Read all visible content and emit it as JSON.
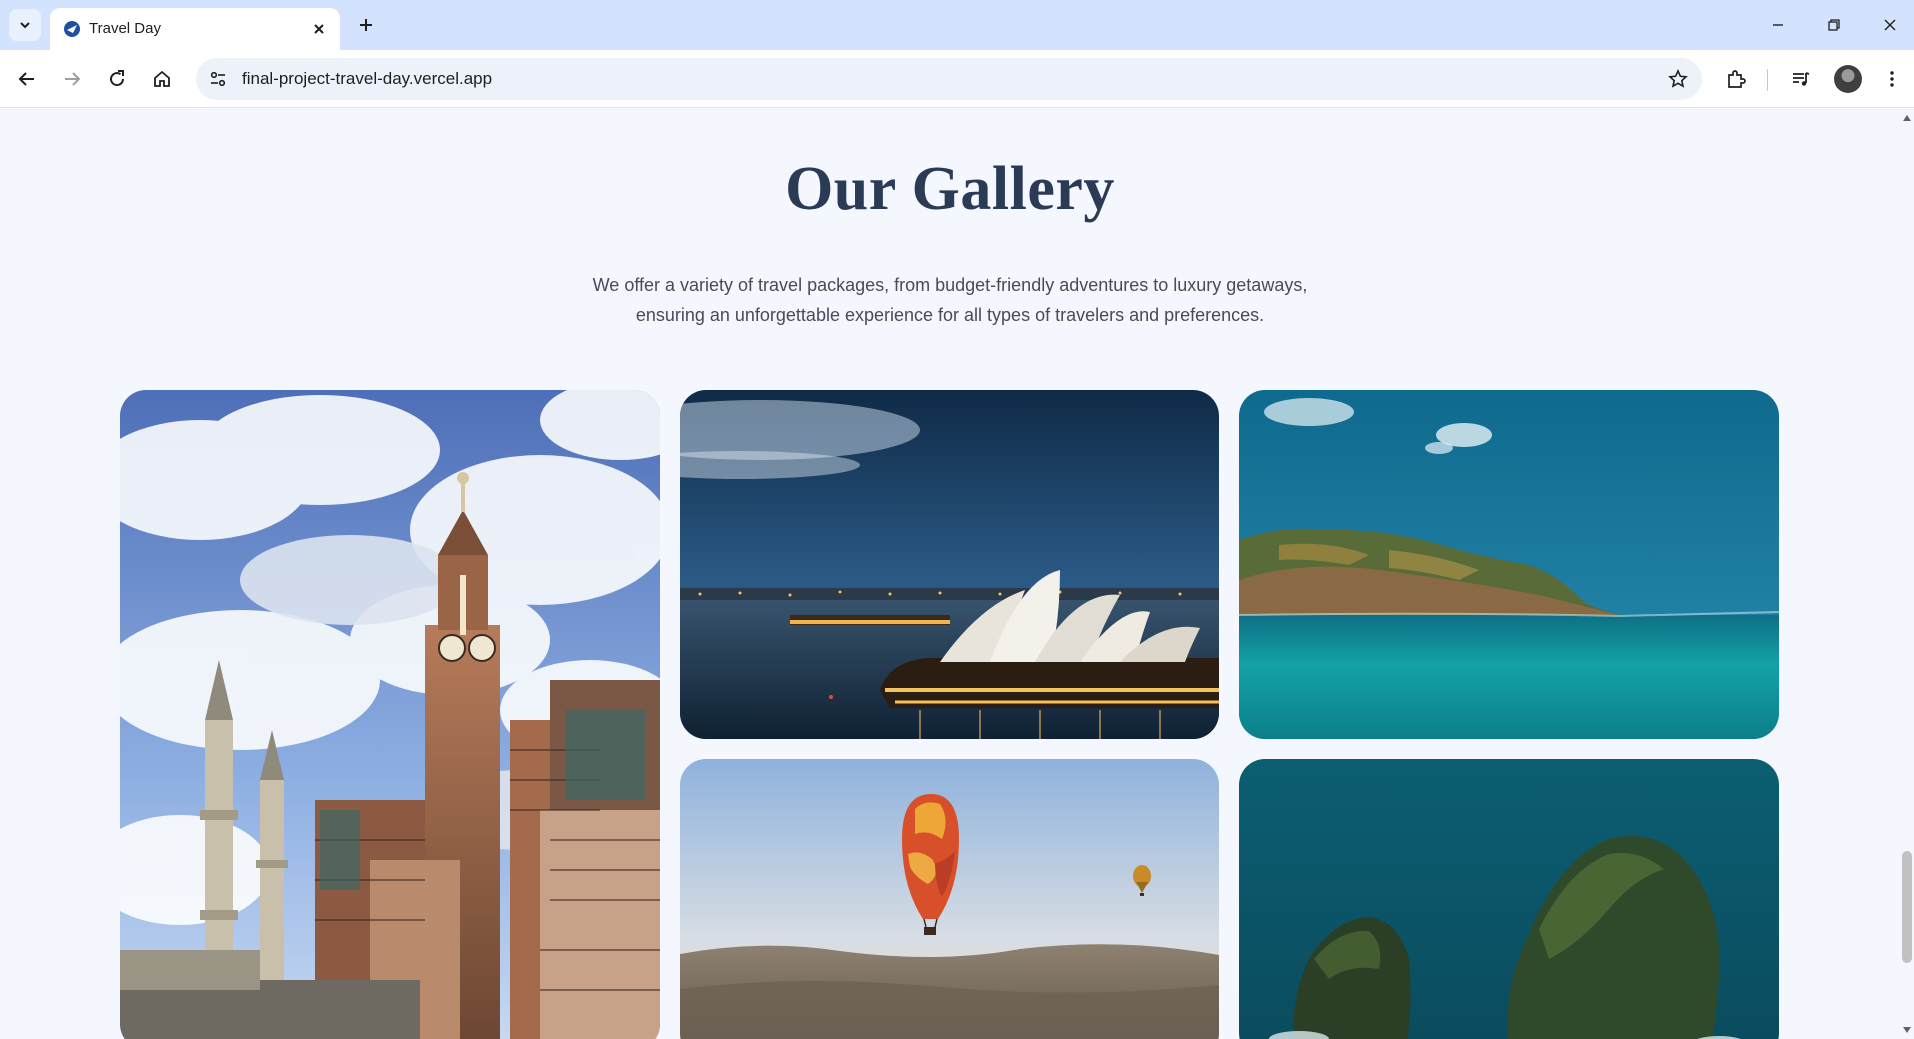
{
  "browser": {
    "tab_title": "Travel Day",
    "url": "final-project-travel-day.vercel.app"
  },
  "gallery": {
    "title": "Our Gallery",
    "description_line1": "We offer a variety of travel packages, from budget-friendly adventures to luxury getaways,",
    "description_line2": "ensuring an unforgettable experience for all types of travelers and preferences.",
    "images": [
      {
        "subject": "Clock tower and minarets under a cloudy sky"
      },
      {
        "subject": "Sydney Opera House at dusk"
      },
      {
        "subject": "Coastal cliffs over turquoise sea"
      },
      {
        "subject": "Hot air balloons over hills at sunrise"
      },
      {
        "subject": "Rocky islet in deep teal ocean"
      }
    ]
  },
  "colors": {
    "title": "#2b3a55",
    "background": "#f4f7fe",
    "tab_strip": "#d3e3fd"
  }
}
